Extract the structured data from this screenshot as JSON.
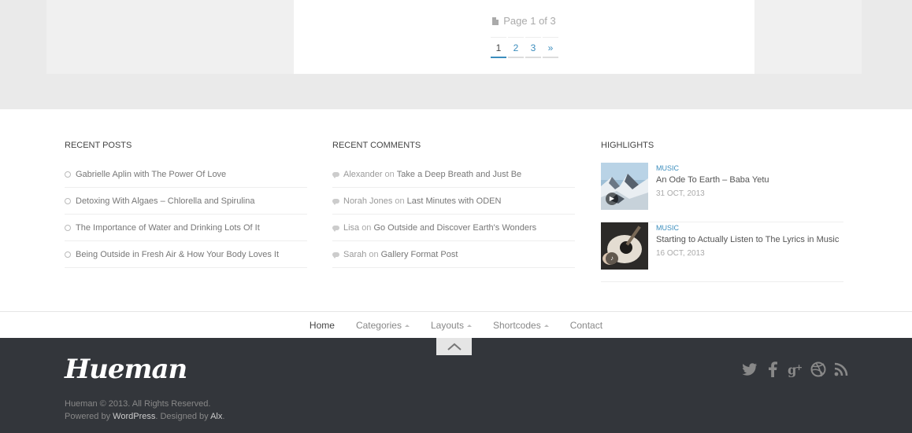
{
  "pagination": {
    "page_info": "Page 1 of 3",
    "pages": [
      "1",
      "2",
      "3",
      "»"
    ],
    "current": "1"
  },
  "recent_posts": {
    "title": "RECENT POSTS",
    "items": [
      "Gabrielle Aplin with The Power Of Love",
      "Detoxing With Algaes – Chlorella and Spirulina",
      "The Importance of Water and Drinking Lots Of It",
      "Being Outside in Fresh Air & How Your Body Loves It"
    ]
  },
  "recent_comments": {
    "title": "RECENT COMMENTS",
    "on_text": "on",
    "items": [
      {
        "author": "Alexander",
        "post": "Take a Deep Breath and Just Be"
      },
      {
        "author": "Norah Jones",
        "post": "Last Minutes with ODEN"
      },
      {
        "author": "Lisa",
        "post": "Go Outside and Discover Earth's Wonders"
      },
      {
        "author": "Sarah",
        "post": "Gallery Format Post"
      }
    ]
  },
  "highlights": {
    "title": "HIGHLIGHTS",
    "items": [
      {
        "category": "MUSIC",
        "title": "An Ode To Earth – Baba Yetu",
        "date": "31 OCT, 2013",
        "overlay_icon": "play-icon"
      },
      {
        "category": "MUSIC",
        "title": "Starting to Actually Listen to The Lyrics in Music",
        "date": "16 OCT, 2013",
        "overlay_icon": "audio-icon"
      }
    ]
  },
  "footer_nav": {
    "items": [
      {
        "label": "Home",
        "dropdown": false
      },
      {
        "label": "Categories",
        "dropdown": true
      },
      {
        "label": "Layouts",
        "dropdown": true
      },
      {
        "label": "Shortcodes",
        "dropdown": true
      },
      {
        "label": "Contact",
        "dropdown": false
      }
    ]
  },
  "footer": {
    "logo": "Hueman",
    "copyright": "Hueman © 2013. All Rights Reserved.",
    "powered_prefix": "Powered by ",
    "powered_link": "WordPress",
    "designed_prefix": ". Designed by ",
    "designed_link": "Alx",
    "designed_suffix": ".",
    "social": [
      "twitter-icon",
      "facebook-icon",
      "google-plus-icon",
      "dribbble-icon",
      "rss-icon"
    ]
  },
  "colors": {
    "accent": "#3b8dbd",
    "footer_bg": "#33363b"
  }
}
